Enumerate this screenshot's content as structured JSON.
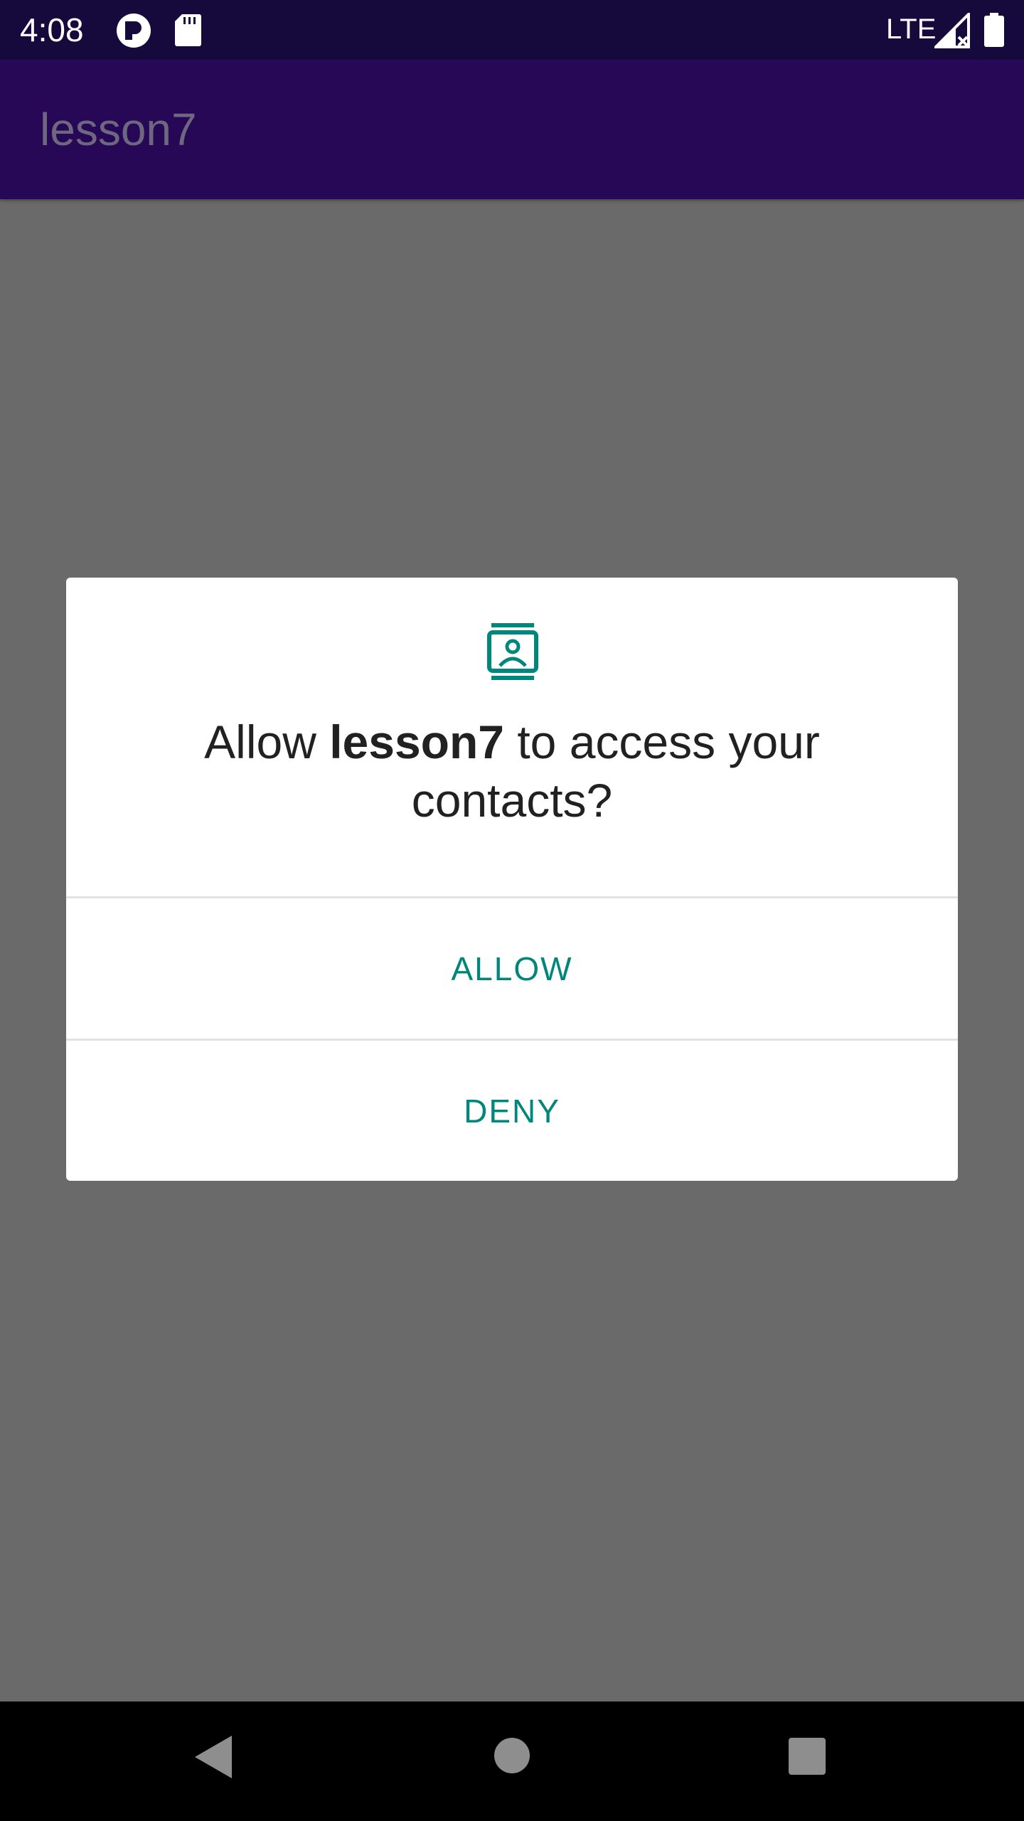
{
  "status_bar": {
    "time": "4:08",
    "network": "LTE",
    "icons": [
      "sync-icon",
      "sd-card-icon",
      "signal-icon",
      "battery-icon"
    ]
  },
  "app_bar": {
    "title": "lesson7"
  },
  "dialog": {
    "icon": "contacts-icon",
    "message_prefix": "Allow ",
    "app_name": "lesson7",
    "message_suffix": " to access your contacts?",
    "allow_label": "ALLOW",
    "deny_label": "DENY"
  },
  "nav_bar": {
    "icons": [
      "back-icon",
      "home-icon",
      "recents-icon"
    ]
  },
  "colors": {
    "status_bar": "#160a3d",
    "app_bar": "#270857",
    "scrim_background": "#6a6a6a",
    "accent": "#00867a",
    "dialog_text": "#212121"
  }
}
